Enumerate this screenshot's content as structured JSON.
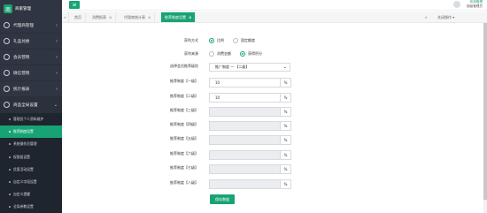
{
  "brand": {
    "logo": "商",
    "label": "商家管理"
  },
  "sidebar": {
    "items": [
      {
        "label": "代理商管理"
      },
      {
        "label": "礼品兑换"
      },
      {
        "label": "会员营销"
      },
      {
        "label": "微信营销"
      },
      {
        "label": "统计报表"
      },
      {
        "label": "商品全局设置"
      }
    ],
    "sub_items": [
      {
        "label": "管理员个人资料维护"
      },
      {
        "label": "推荐制度设置"
      },
      {
        "label": "系统操作员管理"
      },
      {
        "label": "权限组设置"
      },
      {
        "label": "优惠活动设置"
      },
      {
        "label": "自定义字段设置"
      },
      {
        "label": "自定义提醒"
      },
      {
        "label": "全局参数设置"
      }
    ]
  },
  "topbar": {
    "menu_icon": "≡",
    "user_name": "系统管理",
    "user_role": "超级管理员"
  },
  "tabs": {
    "items": [
      {
        "label": "首页"
      },
      {
        "label": "消费报表"
      },
      {
        "label": "代理商统计表"
      },
      {
        "label": "推荐制度设置"
      }
    ],
    "right": {
      "close_ops": "关闭操作"
    }
  },
  "form": {
    "profit_mode": {
      "label": "获利方式",
      "options": [
        "比例",
        "固定额度"
      ],
      "selected": "比例"
    },
    "profit_source": {
      "label": "获利来源",
      "options": [
        "消费金额",
        "获得积分"
      ],
      "selected": "获得积分"
    },
    "level_select": {
      "label": "选择会员推荐级别",
      "value": "推广制度 — 【二级】"
    },
    "levels": [
      {
        "label": "推荐制度【一级】",
        "value": "10",
        "enabled": true
      },
      {
        "label": "推荐制度【二级】",
        "value": "10",
        "enabled": true
      },
      {
        "label": "推荐制度【三级】",
        "value": "",
        "enabled": false
      },
      {
        "label": "推荐制度【四级】",
        "value": "",
        "enabled": false
      },
      {
        "label": "推荐制度【五级】",
        "value": "",
        "enabled": false
      },
      {
        "label": "推荐制度【六级】",
        "value": "",
        "enabled": false
      },
      {
        "label": "推荐制度【七级】",
        "value": "",
        "enabled": false
      },
      {
        "label": "推荐制度【八级】",
        "value": "",
        "enabled": false
      }
    ],
    "unit": "%",
    "save_label": "保存数据"
  },
  "colors": {
    "accent": "#18a374",
    "sidebar_bg": "#2f3542"
  }
}
